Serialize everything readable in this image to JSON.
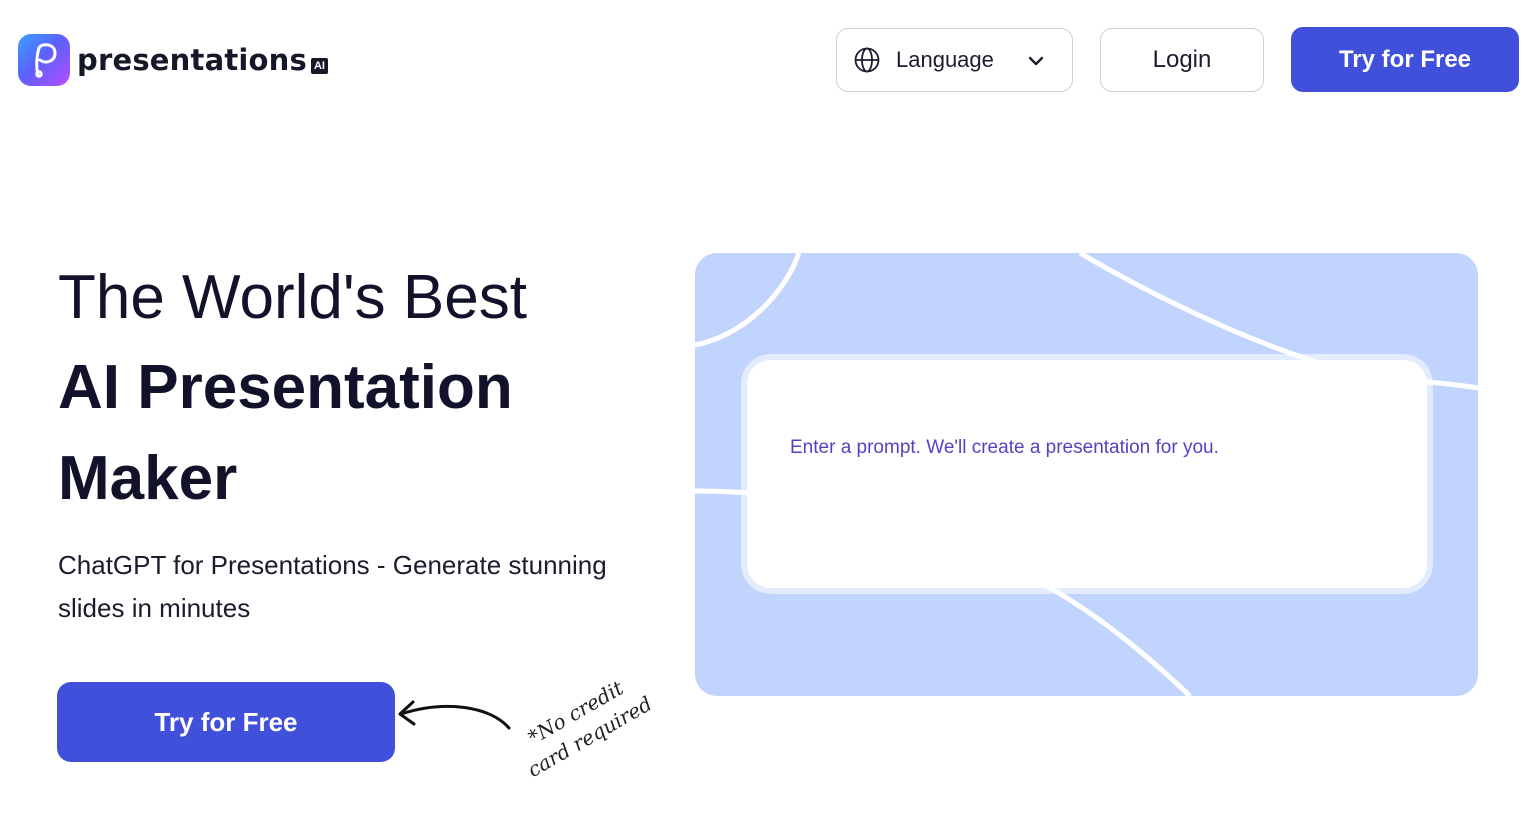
{
  "header": {
    "logo_text": "presentations",
    "logo_badge": "AI",
    "language_label": "Language",
    "login_label": "Login",
    "try_label": "Try for Free"
  },
  "hero": {
    "line1": "The World's Best",
    "line2": "AI Presentation",
    "line3": "Maker",
    "subtitle": "ChatGPT for Presentations - Generate stunning slides in minutes",
    "cta_label": "Try for Free",
    "note_line1": "*No credit",
    "note_line2": "card required"
  },
  "prompt_card": {
    "placeholder": "Enter a prompt. We'll create a presentation for you."
  },
  "colors": {
    "primary": "#4150da",
    "card_bg": "#c1d4fd",
    "placeholder": "#5a3fc2",
    "text_dark": "#12122a"
  },
  "icons": {
    "logo": "presentations-logo-icon",
    "language": "globe-icon",
    "dropdown": "chevron-down-icon",
    "arrow": "curved-arrow-icon"
  }
}
